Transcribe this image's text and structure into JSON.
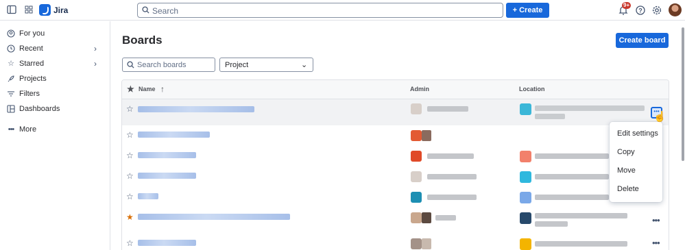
{
  "topnav": {
    "app_name": "Jira",
    "search_placeholder": "Search",
    "create_label": "Create",
    "notification_badge": "9+"
  },
  "sidebar": {
    "items": [
      {
        "label": "For you",
        "icon": "user-circle-icon"
      },
      {
        "label": "Recent",
        "icon": "clock-icon"
      },
      {
        "label": "Starred",
        "icon": "star-icon"
      },
      {
        "label": "Projects",
        "icon": "rocket-icon"
      },
      {
        "label": "Filters",
        "icon": "filter-icon"
      },
      {
        "label": "Dashboards",
        "icon": "dashboard-icon"
      },
      {
        "label": "More",
        "icon": "more-icon"
      }
    ]
  },
  "main": {
    "title": "Boards",
    "create_board_label": "Create board",
    "search_boards_placeholder": "Search boards",
    "project_filter_value": "Project"
  },
  "table": {
    "headers": {
      "name": "Name",
      "admin": "Admin",
      "location": "Location"
    },
    "rows": [
      {
        "starred": false,
        "hovered": true
      },
      {
        "starred": false
      },
      {
        "starred": false
      },
      {
        "starred": false
      },
      {
        "starred": false
      },
      {
        "starred": true
      },
      {
        "starred": false
      }
    ]
  },
  "context_menu": {
    "items": [
      "Edit settings",
      "Copy",
      "Move",
      "Delete"
    ]
  },
  "colors": {
    "primary": "#1868db",
    "badge": "#c9372c",
    "star_favorite": "#d97008"
  }
}
